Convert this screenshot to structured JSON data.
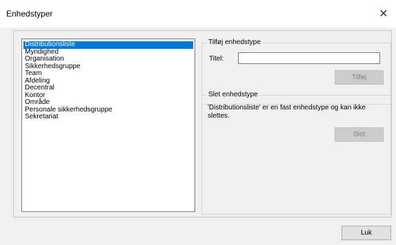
{
  "window": {
    "title": "Enhedstyper",
    "close_glyph": "✕"
  },
  "list": {
    "items": [
      {
        "label": "Distributionsliste",
        "selected": true
      },
      {
        "label": "Myndighed"
      },
      {
        "label": "Organisation"
      },
      {
        "label": "Sikkerhedsgruppe"
      },
      {
        "label": "Team"
      },
      {
        "label": "Afdeling"
      },
      {
        "label": "Decentral"
      },
      {
        "label": "Kontor"
      },
      {
        "label": "Område"
      },
      {
        "label": "Personale sikkerhedsgruppe"
      },
      {
        "label": "Sekretariat"
      }
    ]
  },
  "add_group": {
    "legend": "Tilføj enhedstype",
    "titel_label": "Titel:",
    "titel_value": "",
    "add_button": "Tilføj",
    "add_button_disabled": true
  },
  "delete_group": {
    "legend": "Slet enhedstype",
    "message": "'Distributionsliste' er en fast enhedstype og kan ikke slettes.",
    "delete_button": "Slet",
    "delete_button_disabled": true
  },
  "footer": {
    "close_button": "Luk"
  },
  "colors": {
    "selection": "#0078d7",
    "dialog_bg": "#f0f0f0"
  }
}
